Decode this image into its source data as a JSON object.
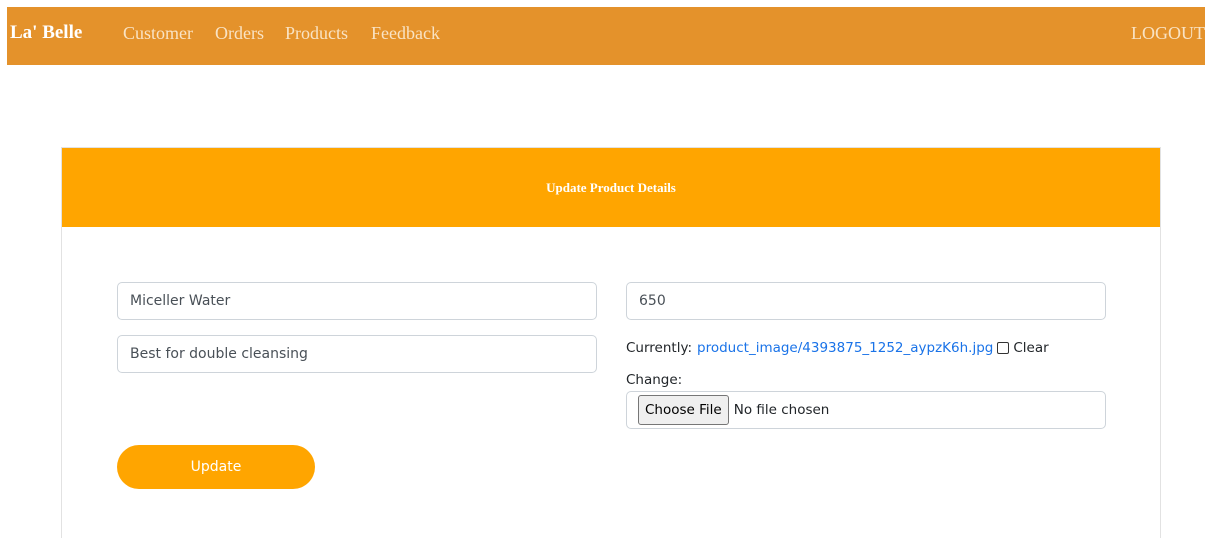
{
  "nav": {
    "brand": "La' Belle",
    "links": [
      "Customer",
      "Orders",
      "Products",
      "Feedback"
    ],
    "logout": "LOGOUT"
  },
  "form": {
    "title": "Update Product Details",
    "name_value": "Miceller Water",
    "price_value": "650",
    "description_value": "Best for double cleansing",
    "currently_label": "Currently:",
    "current_image": "product_image/4393875_1252_aypzK6h.jpg",
    "clear_label": "Clear",
    "change_label": "Change:",
    "choose_file_label": "Choose File",
    "no_file_text": "No file chosen",
    "submit_label": "Update"
  },
  "colors": {
    "navbar": "#e4922b",
    "header": "#ffa500",
    "button": "#ffa500",
    "link": "#1a73e8"
  }
}
